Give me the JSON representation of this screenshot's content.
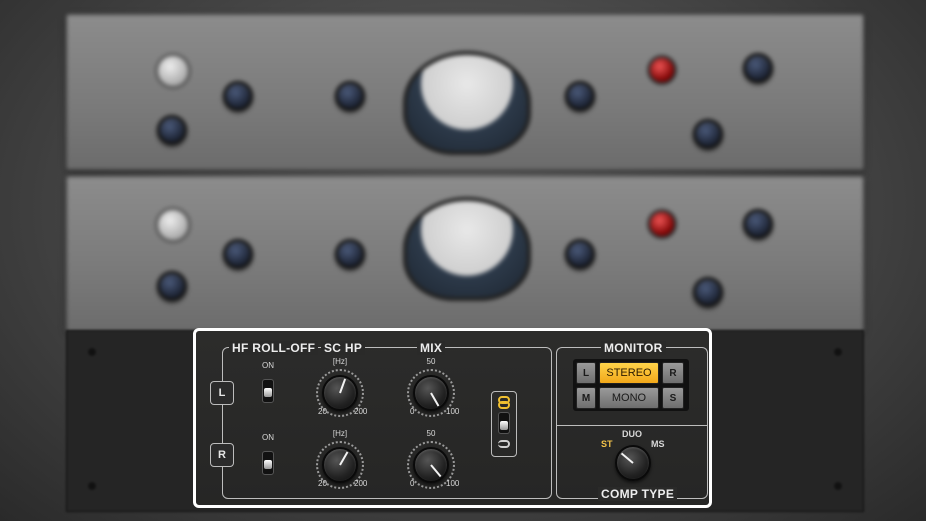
{
  "panel": {
    "sections": {
      "hf_rolloff": "HF ROLL-OFF",
      "sc_hp": "SC HP",
      "mix": "MIX",
      "monitor": "MONITOR",
      "comp_type": "COMP TYPE"
    },
    "channels": [
      {
        "id": "L",
        "label": "L",
        "hf_on_label": "ON",
        "sc_hp_unit": "[Hz]",
        "sc_hp_min": "20",
        "sc_hp_max": "200",
        "mix_top": "50",
        "mix_min": "0",
        "mix_max": "100"
      },
      {
        "id": "R",
        "label": "R",
        "hf_on_label": "ON",
        "sc_hp_unit": "[Hz]",
        "sc_hp_min": "20",
        "sc_hp_max": "200",
        "mix_top": "50",
        "mix_min": "0",
        "mix_max": "100"
      }
    ],
    "monitor": {
      "buttons": [
        {
          "label": "L",
          "active": false
        },
        {
          "label": "STEREO",
          "active": true
        },
        {
          "label": "R",
          "active": false
        },
        {
          "label": "M",
          "active": false
        },
        {
          "label": "MONO",
          "active": false
        },
        {
          "label": "S",
          "active": false
        }
      ]
    },
    "comp_type": {
      "options": [
        "ST",
        "DUO",
        "MS"
      ],
      "selected": "ST"
    },
    "colors": {
      "accent": "#f2b320",
      "selected_option": "#f2c24a",
      "highlight_border": "#ffffff"
    }
  }
}
